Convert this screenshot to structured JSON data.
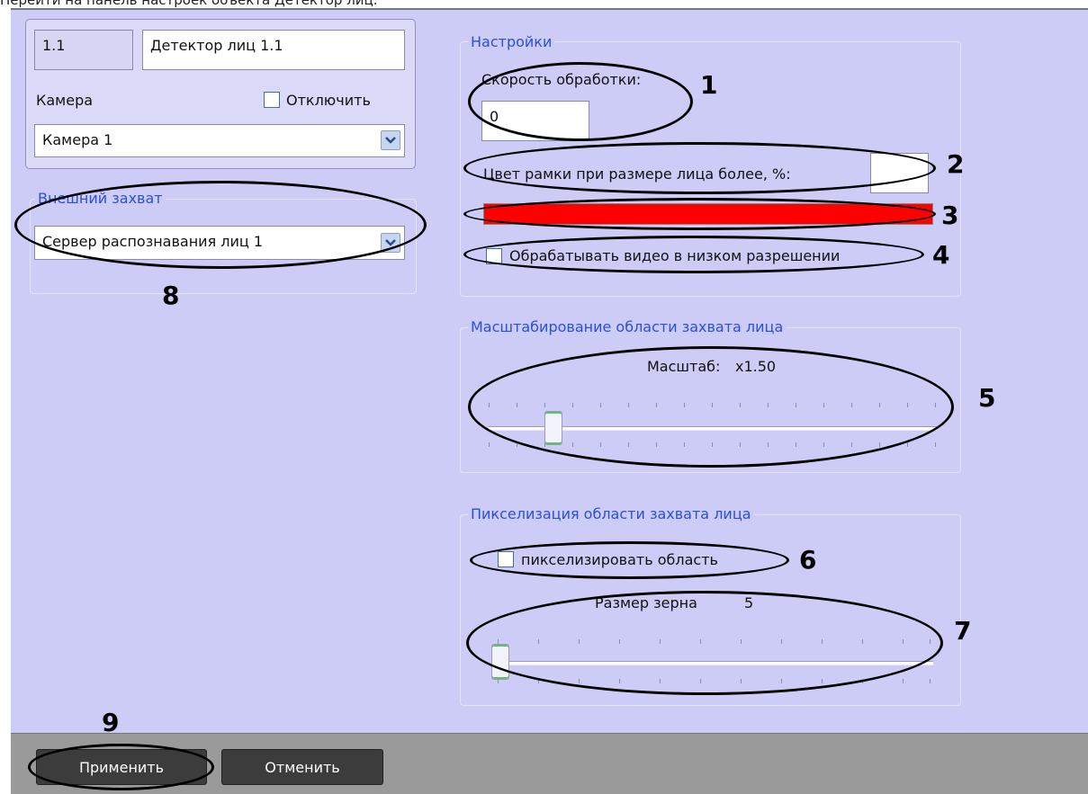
{
  "caption": "Перейти на панель настроек объекта Детектор лиц.",
  "object": {
    "id": "1.1",
    "name": "Детектор лиц 1.1"
  },
  "camera": {
    "label": "Камера",
    "disable_label": "Отключить",
    "selected": "Камера 1"
  },
  "external_capture": {
    "title": "Внешний захват",
    "selected": "Сервер распознавания лиц 1"
  },
  "settings": {
    "title": "Настройки",
    "speed_label": "Скорость обработки:",
    "speed_value": "0",
    "frame_color_label": "Цвет рамки при размере лица более, %:",
    "frame_color_value": "",
    "frame_color": "#ff0000",
    "low_res_label": "Обрабатывать видео в низком разрешении"
  },
  "scaling": {
    "title": "Масштабирование области захвата лица",
    "scale_label": "Масштаб:",
    "scale_value": "x1.50"
  },
  "pixelation": {
    "title": "Пикселизация области захвата лица",
    "checkbox_label": "пикселизировать область",
    "grain_label": "Размер зерна",
    "grain_value": "5"
  },
  "buttons": {
    "apply": "Применить",
    "cancel": "Отменить"
  },
  "callouts": [
    "1",
    "2",
    "3",
    "4",
    "5",
    "6",
    "7",
    "8",
    "9"
  ],
  "colors": {
    "panel": "#ccccf7",
    "group_title": "#2b4fd8",
    "footer": "#9a9a9a"
  }
}
